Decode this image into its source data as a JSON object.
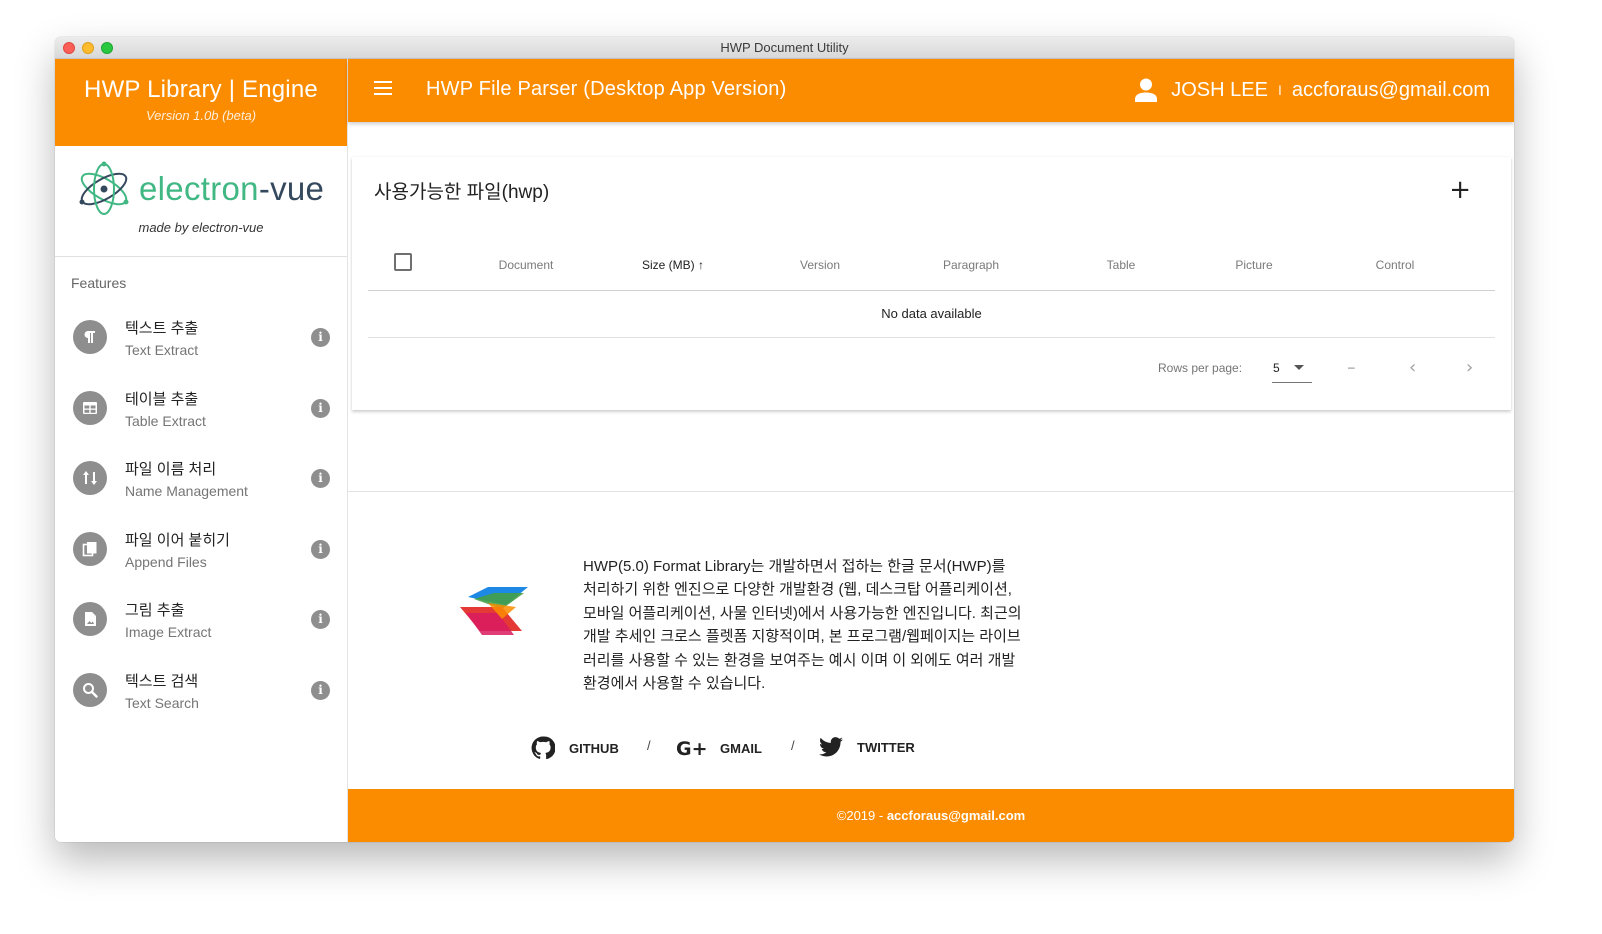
{
  "window": {
    "title": "HWP Document Utility"
  },
  "sidebar": {
    "title": "HWP Library | Engine",
    "version": "Version 1.0b (beta)",
    "logo_word_part1": "electron",
    "logo_word_part2": "-vue",
    "logo_caption": "made by electron-vue",
    "features_label": "Features",
    "items": [
      {
        "title": "텍스트 추출",
        "subtitle": "Text Extract",
        "icon": "paragraph-icon"
      },
      {
        "title": "테이블 추출",
        "subtitle": "Table Extract",
        "icon": "table-icon"
      },
      {
        "title": "파일 이름 처리",
        "subtitle": "Name Management",
        "icon": "sort-icon"
      },
      {
        "title": "파일 이어 붙히기",
        "subtitle": "Append Files",
        "icon": "copy-files-icon"
      },
      {
        "title": "그림 추출",
        "subtitle": "Image Extract",
        "icon": "image-file-icon"
      },
      {
        "title": "텍스트 검색",
        "subtitle": "Text Search",
        "icon": "search-icon"
      }
    ]
  },
  "appbar": {
    "title": "HWP File Parser (Desktop App Version)",
    "user_name": "JOSH LEE",
    "separator": "I",
    "user_email": "accforaus@gmail.com"
  },
  "card": {
    "title": "사용가능한 파일(hwp)",
    "add_label": "+",
    "columns": [
      "Document",
      "Size (MB) ↑",
      "Version",
      "Paragraph",
      "Table",
      "Picture",
      "Control"
    ],
    "empty_text": "No data available",
    "rows_per_page_label": "Rows per page:",
    "rows_per_page_value": "5",
    "range_text": "–",
    "prev": "‹",
    "next": "›"
  },
  "about": {
    "description": "HWP(5.0) Format Library는 개발하면서 접하는 한글 문서(HWP)를 처리하기 위한 엔진으로 다양한 개발환경 (웹, 데스크탑 어플리케이션, 모바일 어플리케이션, 사물 인터넷)에서 사용가능한 엔진입니다. 최근의 개발 추세인 크로스 플렛폼 지향적이며, 본 프로그램/웹페이지는 라이브러리를 사용할 수 있는 환경을 보여주는 예시 이며 이 외에도 여러 개발 환경에서 사용할 수 있습니다."
  },
  "links": {
    "github": "GITHUB",
    "gmail": "GMAIL",
    "twitter": "TWITTER",
    "slash": "/"
  },
  "footer": {
    "prefix": "©2019 - ",
    "email": "accforaus@gmail.com"
  },
  "colors": {
    "accent": "#fb8c00",
    "electron_green": "#41b883",
    "icon_gray": "#8e8e8e"
  }
}
